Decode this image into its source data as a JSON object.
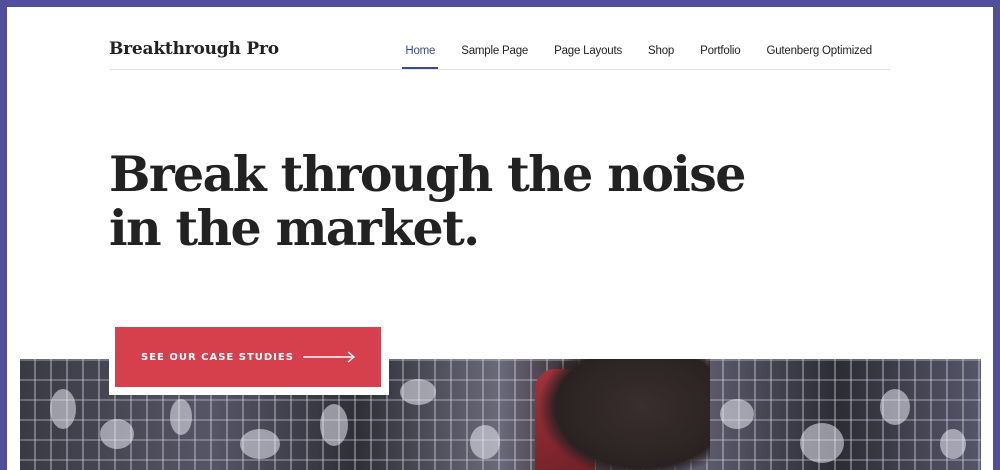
{
  "site": {
    "title": "Breakthrough Pro"
  },
  "nav": {
    "items": [
      {
        "label": "Home",
        "active": true
      },
      {
        "label": "Sample Page"
      },
      {
        "label": "Page Layouts"
      },
      {
        "label": "Shop"
      },
      {
        "label": "Portfolio"
      },
      {
        "label": "Gutenberg Optimized"
      }
    ]
  },
  "hero": {
    "line1": "Break through the noise",
    "line2": "in the market."
  },
  "cta": {
    "label": "SEE OUR CASE STUDIES",
    "icon": "arrow-right-icon"
  },
  "colors": {
    "frame": "#4f4f9c",
    "accent": "#d5404c",
    "nav_active": "#3c4b8a",
    "text": "#222222"
  }
}
